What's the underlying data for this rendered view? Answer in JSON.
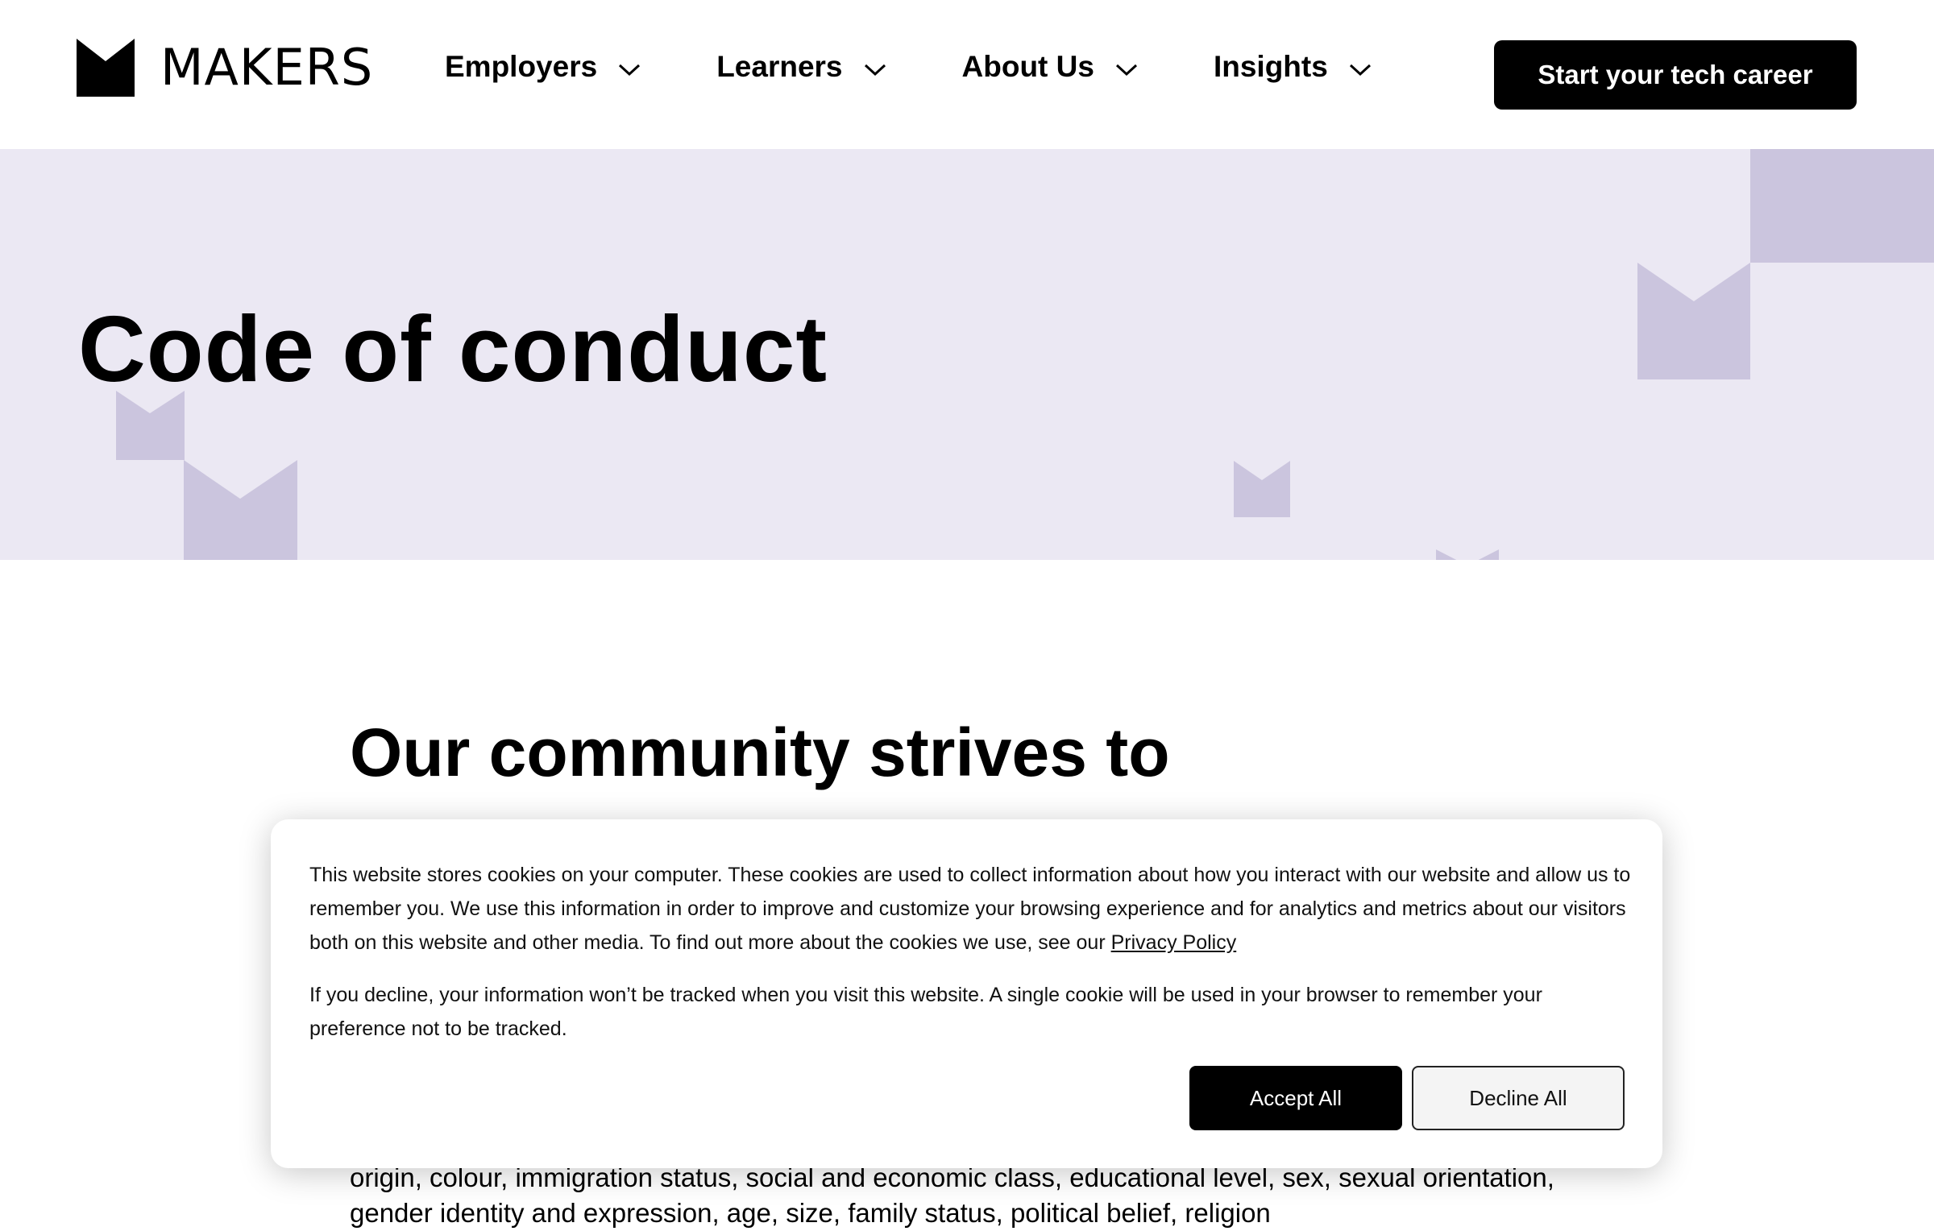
{
  "header": {
    "logo_text": "MAKERS",
    "nav": [
      {
        "label": "Employers"
      },
      {
        "label": "Learners"
      },
      {
        "label": "About Us"
      },
      {
        "label": "Insights"
      }
    ],
    "cta_label": "Start your tech career"
  },
  "hero": {
    "title": "Code of conduct",
    "background": "#ebe8f3",
    "deco_color": "#cbc5de"
  },
  "content": {
    "subheading": "Our community strives to",
    "body_partial": "origin, colour, immigration status, social and economic class, educational level, sex, sexual orientation, gender identity and expression, age, size, family status, political belief, religion"
  },
  "cookie_banner": {
    "paragraph1": "This website stores cookies on your computer. These cookies are used to collect information about how you interact with our website and allow us to remember you. We use this information in order to improve and customize your browsing experience and for analytics and metrics about our visitors both on this website and other media. To find out more about the cookies we use, see our",
    "privacy_link": "Privacy Policy",
    "paragraph2": "If you decline, your information won’t be tracked when you visit this website. A single cookie will be used in your browser to remember your preference not to be tracked.",
    "accept_label": "Accept All",
    "decline_label": "Decline All"
  }
}
